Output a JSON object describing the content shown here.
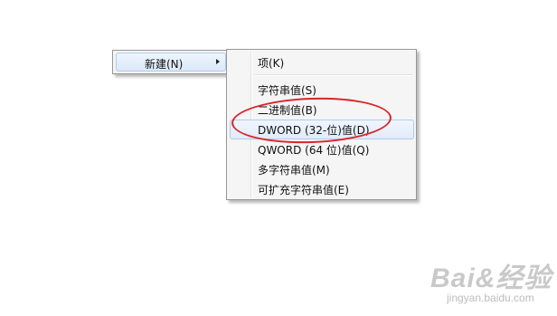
{
  "context_menu": {
    "parent_item": {
      "label": "新建(N)"
    },
    "submenu": {
      "items": [
        {
          "label": "项(K)"
        },
        {
          "label": "字符串值(S)"
        },
        {
          "label": "二进制值(B)"
        },
        {
          "label": "DWORD (32-位)值(D)",
          "state": "hovered"
        },
        {
          "label": "QWORD (64 位)值(Q)"
        },
        {
          "label": "多字符串值(M)"
        },
        {
          "label": "可扩充字符串值(E)"
        }
      ]
    }
  },
  "annotation": {
    "shape": "ellipse",
    "color": "#d9252a",
    "target": "DWORD (32-位)值(D)"
  },
  "watermark": {
    "logo_text": "Bai&经验",
    "url": "jingyan.baidu.com"
  },
  "colors": {
    "menu_background": "#f5f5f5",
    "menu_border": "#979797",
    "hover_border": "#aecbec",
    "annotation_red": "#d9252a"
  }
}
